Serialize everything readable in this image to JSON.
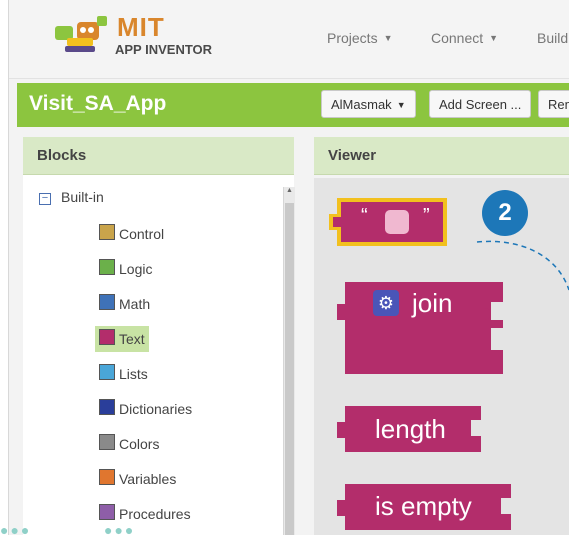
{
  "app": {
    "logo_title": "MIT",
    "logo_subtitle": "APP INVENTOR"
  },
  "nav": {
    "items": [
      {
        "label": "Projects"
      },
      {
        "label": "Connect"
      },
      {
        "label": "Build"
      }
    ]
  },
  "project": {
    "name": "Visit_SA_App",
    "screen_select": "AlMasmak",
    "add_screen": "Add Screen ...",
    "remove_screen": "Remove Screen"
  },
  "blocks_panel": {
    "title": "Blocks",
    "builtin_label": "Built-in",
    "categories": [
      {
        "label": "Control",
        "color": "#c9a44b"
      },
      {
        "label": "Logic",
        "color": "#6bb04a"
      },
      {
        "label": "Math",
        "color": "#3f72b8"
      },
      {
        "label": "Text",
        "color": "#b32d6b",
        "selected": true
      },
      {
        "label": "Lists",
        "color": "#4aa6d8"
      },
      {
        "label": "Dictionaries",
        "color": "#2a3e9a"
      },
      {
        "label": "Colors",
        "color": "#8a8a8a"
      },
      {
        "label": "Variables",
        "color": "#e0762f"
      },
      {
        "label": "Procedures",
        "color": "#8e5ea8"
      }
    ]
  },
  "viewer": {
    "title": "Viewer",
    "blocks": {
      "string_quote_open": "“",
      "string_quote_close": "”",
      "join": "join",
      "length": "length",
      "is_empty": "is empty"
    },
    "block_color": "#b32d6b",
    "highlight_color": "#f2c01e"
  },
  "callout": {
    "number": "2",
    "color": "#1d77b8"
  }
}
